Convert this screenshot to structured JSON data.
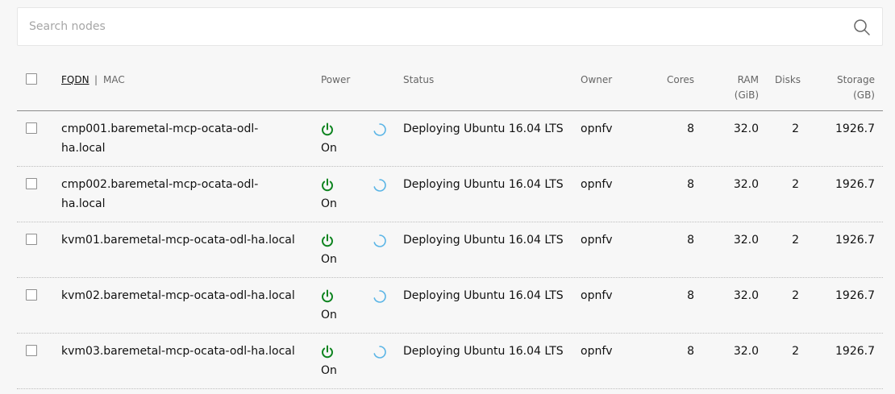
{
  "search": {
    "placeholder": "Search nodes",
    "icon": "search-icon"
  },
  "header": {
    "fqdn": "FQDN",
    "separator": "|",
    "mac": "MAC",
    "power": "Power",
    "status": "Status",
    "owner": "Owner",
    "cores": "Cores",
    "ram": "RAM",
    "ram_unit": "(GiB)",
    "disks": "Disks",
    "storage": "Storage",
    "storage_unit": "(GB)"
  },
  "colors": {
    "power_on": "#0e8420",
    "spinner": "#5ab5e6",
    "border": "#8a8a8a"
  },
  "nodes": [
    {
      "fqdn_line1": "cmp001.baremetal-mcp-ocata-odl-",
      "fqdn_line2": "ha.local",
      "power_icon": "power-icon",
      "power": "On",
      "status_icon": "spinner-icon",
      "status": "Deploying Ubuntu 16.04 LTS",
      "owner": "opnfv",
      "cores": "8",
      "ram": "32.0",
      "disks": "2",
      "storage": "1926.7"
    },
    {
      "fqdn_line1": "cmp002.baremetal-mcp-ocata-odl-",
      "fqdn_line2": "ha.local",
      "power_icon": "power-icon",
      "power": "On",
      "status_icon": "spinner-icon",
      "status": "Deploying Ubuntu 16.04 LTS",
      "owner": "opnfv",
      "cores": "8",
      "ram": "32.0",
      "disks": "2",
      "storage": "1926.7"
    },
    {
      "fqdn_line1": "kvm01.baremetal-mcp-ocata-odl-ha.local",
      "fqdn_line2": "",
      "power_icon": "power-icon",
      "power": "On",
      "status_icon": "spinner-icon",
      "status": "Deploying Ubuntu 16.04 LTS",
      "owner": "opnfv",
      "cores": "8",
      "ram": "32.0",
      "disks": "2",
      "storage": "1926.7"
    },
    {
      "fqdn_line1": "kvm02.baremetal-mcp-ocata-odl-ha.local",
      "fqdn_line2": "",
      "power_icon": "power-icon",
      "power": "On",
      "status_icon": "spinner-icon",
      "status": "Deploying Ubuntu 16.04 LTS",
      "owner": "opnfv",
      "cores": "8",
      "ram": "32.0",
      "disks": "2",
      "storage": "1926.7"
    },
    {
      "fqdn_line1": "kvm03.baremetal-mcp-ocata-odl-ha.local",
      "fqdn_line2": "",
      "power_icon": "power-icon",
      "power": "On",
      "status_icon": "spinner-icon",
      "status": "Deploying Ubuntu 16.04 LTS",
      "owner": "opnfv",
      "cores": "8",
      "ram": "32.0",
      "disks": "2",
      "storage": "1926.7"
    }
  ]
}
